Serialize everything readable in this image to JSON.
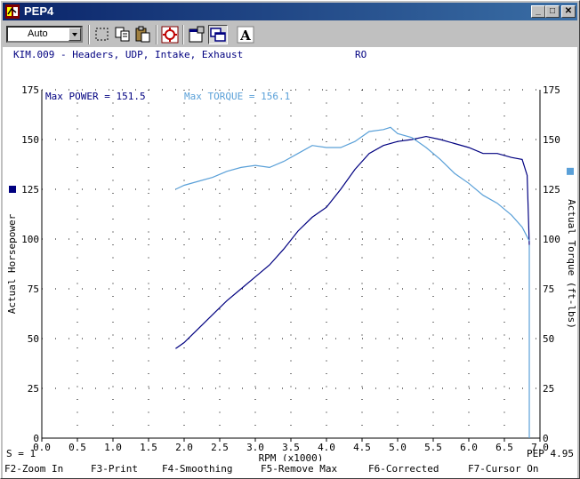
{
  "window": {
    "title": "PEP4",
    "minimize_glyph": "_",
    "maximize_glyph": "□",
    "close_glyph": "✕"
  },
  "toolbar": {
    "mode_select_value": "Auto",
    "tools": [
      "select-rect-icon",
      "copy-icon",
      "paste-icon",
      "target-icon",
      "properties-icon",
      "overlay-windows-icon",
      "font-icon"
    ],
    "font_glyph": "A"
  },
  "run": {
    "description": "KIM.009 - Headers, UDP, Intake, Exhaust",
    "tag": "RO"
  },
  "status": {
    "smoothing": "S = 1",
    "version": "PEP 4.95"
  },
  "function_keys": [
    "F2-Zoom In",
    "F3-Print",
    "F4-Smoothing",
    "F5-Remove Max",
    "F6-Corrected",
    "F7-Cursor On"
  ],
  "colors": {
    "power": "#000080",
    "torque": "#5aa0d8",
    "grid": "#000000"
  },
  "chart_data": {
    "type": "line",
    "title": "",
    "xlabel": "RPM (x1000)",
    "ylabel": "Actual Horsepower",
    "y2label": "Actual Torque (ft-lbs)",
    "xlim": [
      0,
      7
    ],
    "ylim": [
      0,
      175
    ],
    "y2lim": [
      0,
      175
    ],
    "x_ticks": [
      "0.0",
      "0.5",
      "1.0",
      "1.5",
      "2.0",
      "2.5",
      "3.0",
      "3.5",
      "4.0",
      "4.5",
      "5.0",
      "5.5",
      "6.0",
      "6.5",
      "7.0"
    ],
    "y_ticks": [
      "0",
      "25",
      "50",
      "75",
      "100",
      "125",
      "150",
      "175"
    ],
    "annotations": {
      "max_power": "Max POWER = 151.5",
      "max_torque": "Max TORQUE = 156.1"
    },
    "series": [
      {
        "name": "POWER",
        "x": [
          1.88,
          2.0,
          2.2,
          2.4,
          2.6,
          2.8,
          3.0,
          3.2,
          3.4,
          3.6,
          3.8,
          4.0,
          4.2,
          4.4,
          4.6,
          4.8,
          5.0,
          5.2,
          5.4,
          5.6,
          5.8,
          6.0,
          6.2,
          6.4,
          6.6,
          6.75,
          6.82,
          6.85
        ],
        "values": [
          45,
          48,
          55,
          62,
          69,
          75,
          81,
          87,
          95,
          104,
          111,
          116,
          125,
          135,
          143,
          147,
          149,
          150,
          151.5,
          150,
          148,
          146,
          143,
          143,
          141,
          140,
          132,
          97
        ]
      },
      {
        "name": "TORQUE",
        "x": [
          1.88,
          2.0,
          2.2,
          2.4,
          2.6,
          2.8,
          3.0,
          3.2,
          3.4,
          3.6,
          3.8,
          4.0,
          4.2,
          4.4,
          4.6,
          4.8,
          4.9,
          5.0,
          5.2,
          5.4,
          5.6,
          5.8,
          6.0,
          6.2,
          6.4,
          6.6,
          6.75,
          6.85
        ],
        "values": [
          125,
          127,
          129,
          131,
          134,
          136,
          137,
          136,
          139,
          143,
          147,
          146,
          146,
          149,
          154,
          155,
          156.1,
          153,
          151,
          146,
          140,
          133,
          128,
          122,
          118,
          112,
          106,
          99
        ]
      }
    ]
  }
}
